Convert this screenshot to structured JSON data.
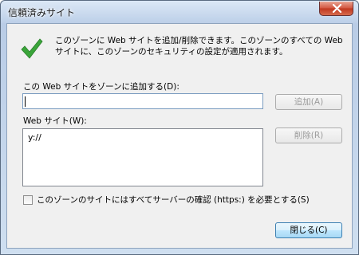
{
  "window": {
    "title": "信頼済みサイト"
  },
  "intro": {
    "text": "このゾーンに Web サイトを追加/削除できます。このゾーンのすべての Web サイトに、このゾーンのセキュリティの設定が適用されます。"
  },
  "add": {
    "label": "この Web サイトをゾーンに追加する(D):",
    "input_value": "",
    "button_label": "追加(A)"
  },
  "sites": {
    "label": "Web サイト(W):",
    "items": [
      "y://"
    ],
    "remove_label": "削除(R)"
  },
  "https": {
    "label": "このゾーンのサイトにはすべてサーバーの確認 (https:) を必要とする(S)",
    "checked": false
  },
  "footer": {
    "close_label": "閉じる(C)"
  },
  "colors": {
    "check_green": "#3aa53a",
    "close_red": "#c9452c",
    "disabled_text": "#9b9b9b"
  },
  "icons": {
    "status": "check-icon",
    "window_close": "close-icon"
  }
}
